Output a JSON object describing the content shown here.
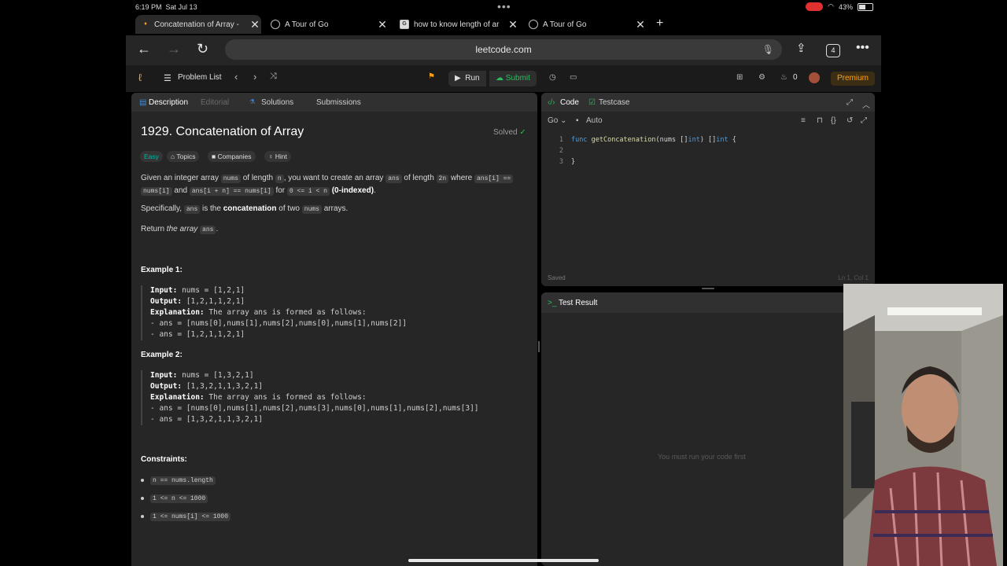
{
  "status_bar": {
    "time": "6:19 PM",
    "date": "Sat Jul 13",
    "battery": "43%",
    "battery_level": 0.43
  },
  "browser": {
    "tabs": [
      {
        "title": "Concatenation of Array -",
        "active": true
      },
      {
        "title": "A Tour of Go",
        "active": false
      },
      {
        "title": "how to know length of ar",
        "active": false
      },
      {
        "title": "A Tour of Go",
        "active": false
      }
    ],
    "tab_count": "4",
    "url": "leetcode.com"
  },
  "lc_nav": {
    "problem_list": "Problem List",
    "run": "Run",
    "submit": "Submit",
    "streak": "0",
    "premium": "Premium"
  },
  "left_panel": {
    "tabs": [
      "Description",
      "Editorial",
      "Solutions",
      "Submissions"
    ],
    "title": "1929. Concatenation of Array",
    "solved": "Solved",
    "chips": [
      "Easy",
      "Topics",
      "Companies",
      "Hint"
    ],
    "desc": {
      "p1a": "Given an integer array",
      "nums": "nums",
      "p1b": "of length",
      "n": "n",
      "p1c": ", you want to create an array",
      "ans": "ans",
      "p1d": "of length",
      "two_n": "2n",
      "p1e": "where",
      "c1": "ans[i] ==",
      "c2": "nums[i]",
      "p1f": "and",
      "c3": "ans[i + n] == nums[i]",
      "p1g": "for",
      "c4": "0 <= i < n",
      "p1h": "(0-indexed)",
      "p1i": ".",
      "p2a": "Specifically,",
      "p2b": "is the",
      "p2c": "concatenation",
      "p2d": "of two",
      "p2e": "arrays.",
      "p3a": "Return",
      "p3b": "the array",
      "p3c": "."
    },
    "example1": {
      "heading": "Example 1:",
      "input_label": "Input:",
      "input": "nums = [1,2,1]",
      "output_label": "Output:",
      "output": "[1,2,1,1,2,1]",
      "expl_label": "Explanation:",
      "expl": "The array ans is formed as follows:",
      "line1": "- ans = [nums[0],nums[1],nums[2],nums[0],nums[1],nums[2]]",
      "line2": "- ans = [1,2,1,1,2,1]"
    },
    "example2": {
      "heading": "Example 2:",
      "input_label": "Input:",
      "input": "nums = [1,3,2,1]",
      "output_label": "Output:",
      "output": "[1,3,2,1,1,3,2,1]",
      "expl_label": "Explanation:",
      "expl": "The array ans is formed as follows:",
      "line1": "- ans = [nums[0],nums[1],nums[2],nums[3],nums[0],nums[1],nums[2],nums[3]]",
      "line2": "- ans = [1,3,2,1,1,3,2,1]"
    },
    "constraints_heading": "Constraints:",
    "constraints": [
      "n == nums.length",
      "1 <= n <= 1000",
      "1 <= nums[i] <= 1000"
    ]
  },
  "code_panel": {
    "tabs": [
      "Code",
      "Testcase"
    ],
    "language": "Go",
    "mode": "Auto",
    "lines": [
      {
        "n": "1",
        "text": "func getConcatenation(nums []int) []int {"
      },
      {
        "n": "2",
        "text": ""
      },
      {
        "n": "3",
        "text": "}"
      }
    ],
    "saved": "Saved",
    "cursor": "Ln 1, Col 1"
  },
  "result_panel": {
    "title": "Test Result",
    "message": "You must run your code first"
  },
  "colors": {
    "accent": "#ffa116",
    "green": "#2cbb5d",
    "easy": "#00b8a3",
    "blue": "#3c8de2"
  }
}
